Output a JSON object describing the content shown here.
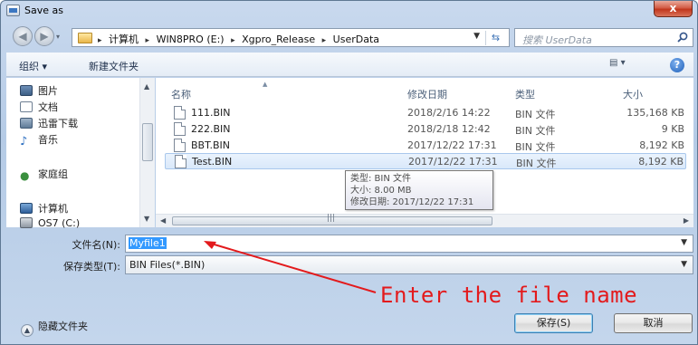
{
  "window": {
    "title": "Save as",
    "close_glyph": "x"
  },
  "address_bar": {
    "crumbs": [
      "计算机",
      "WIN8PRO (E:)",
      "Xgpro_Release",
      "UserData"
    ],
    "separator": "▸"
  },
  "search": {
    "placeholder": "搜索 UserData"
  },
  "toolbar": {
    "organize_label": "组织 ▾",
    "new_folder_label": "新建文件夹",
    "help_glyph": "?"
  },
  "nav_pane": {
    "items": [
      {
        "label": "图片",
        "icon": "pictures-icon"
      },
      {
        "label": "文档",
        "icon": "documents-icon"
      },
      {
        "label": "迅雷下载",
        "icon": "downloads-icon"
      },
      {
        "label": "音乐",
        "icon": "music-icon"
      },
      {
        "label": "家庭组",
        "icon": "homegroup-icon"
      },
      {
        "label": "计算机",
        "icon": "computer-icon"
      },
      {
        "label": "OS7 (C:)",
        "icon": "drive-icon"
      }
    ]
  },
  "file_list": {
    "columns": {
      "name": "名称",
      "date": "修改日期",
      "type": "类型",
      "size": "大小"
    },
    "rows": [
      {
        "name": "111.BIN",
        "date": "2018/2/16 14:22",
        "type": "BIN 文件",
        "size": "135,168 KB"
      },
      {
        "name": "222.BIN",
        "date": "2018/2/18 12:42",
        "type": "BIN 文件",
        "size": "9 KB"
      },
      {
        "name": "BBT.BIN",
        "date": "2017/12/22 17:31",
        "type": "BIN 文件",
        "size": "8,192 KB"
      },
      {
        "name": "Test.BIN",
        "date": "2017/12/22 17:31",
        "type": "BIN 文件",
        "size": "8,192 KB"
      }
    ],
    "selected_index": 3
  },
  "tooltip": {
    "line1": "类型: BIN 文件",
    "line2": "大小: 8.00 MB",
    "line3": "修改日期: 2017/12/22 17:31"
  },
  "form": {
    "filename_label": "文件名(N):",
    "filename_value": "Myfile1",
    "filetype_label": "保存类型(T):",
    "filetype_value": "BIN Files(*.BIN)"
  },
  "annotation": {
    "text": "Enter the file name",
    "color": "#e31a1c"
  },
  "footer": {
    "hide_folders_label": "隐藏文件夹",
    "save_label": "保存(S)",
    "cancel_label": "取消"
  }
}
